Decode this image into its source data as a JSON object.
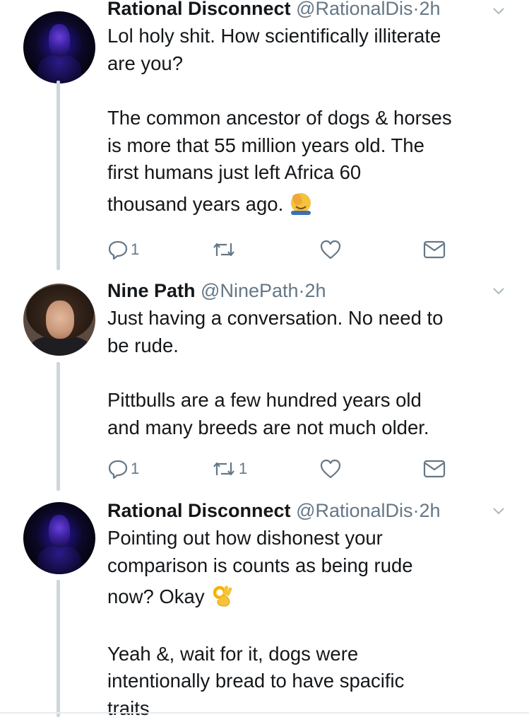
{
  "tweets": [
    {
      "name": "Rational Disconnect",
      "handle": "@RationalDis",
      "dot": "·",
      "time": "2h",
      "lines": [
        "Lol holy shit. How scientifically illiterate",
        "are you?",
        "The common ancestor of dogs & horses",
        "is more that 55 million years old. The",
        "first humans just left Africa 60",
        "thousand years ago."
      ],
      "emoji": "face-palm-emoji",
      "reply_count": "1",
      "retweet_count": "",
      "avatar": "dark-portrait-avatar"
    },
    {
      "name": "Nine Path",
      "handle": "@NinePath",
      "dot": "·",
      "time": "2h",
      "lines": [
        "Just having a conversation. No need to",
        "be rude.",
        "Pittbulls are a few hundred years old",
        "and many breeds are not much older."
      ],
      "reply_count": "1",
      "retweet_count": "1",
      "avatar": "curly-hair-photo-avatar"
    },
    {
      "name": "Rational Disconnect",
      "handle": "@RationalDis",
      "dot": "·",
      "time": "2h",
      "lines": [
        "Pointing out how dishonest your",
        "comparison is counts as being rude",
        "now? Okay",
        "Yeah &, wait for it, dogs were",
        "intentionally bread to have spacific",
        "traits"
      ],
      "emoji": "ok-hand-emoji",
      "avatar": "dark-portrait-avatar"
    }
  ],
  "colors": {
    "text": "#14171a",
    "secondary": "#657786",
    "thread_line": "#ccd6dd",
    "icon": "#657786"
  }
}
